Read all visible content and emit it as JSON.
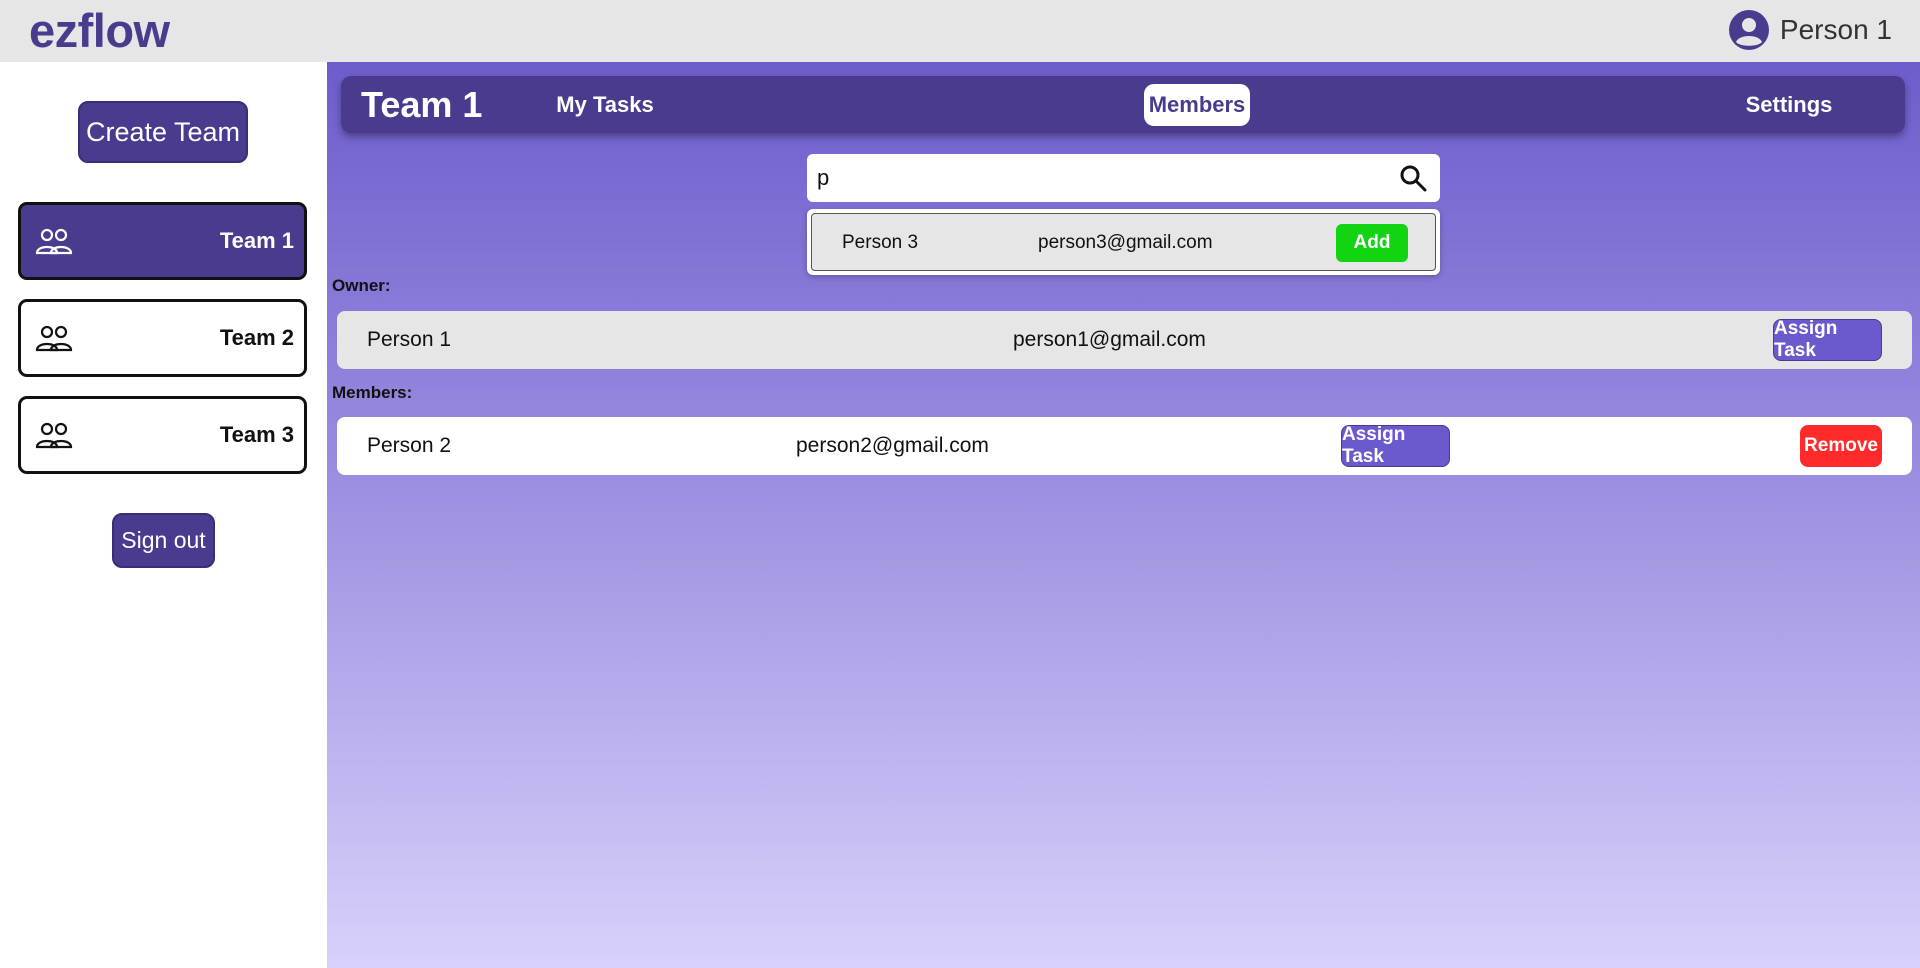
{
  "app": {
    "logo": "ezflow"
  },
  "user": {
    "name": "Person 1",
    "icon": "user-avatar-icon"
  },
  "sidebar": {
    "create_team_label": "Create Team",
    "teams": [
      {
        "label": "Team 1",
        "icon": "team-icon",
        "active": true
      },
      {
        "label": "Team 2",
        "icon": "team-icon",
        "active": false
      },
      {
        "label": "Team 3",
        "icon": "team-icon",
        "active": false
      }
    ],
    "signout_label": "Sign out"
  },
  "team_nav": {
    "title": "Team 1",
    "tabs": [
      {
        "label": "My Tasks",
        "active": false
      },
      {
        "label": "Members",
        "active": true
      },
      {
        "label": "Settings",
        "active": false
      }
    ]
  },
  "search": {
    "value": "p",
    "icon": "search-icon"
  },
  "search_results": [
    {
      "name": "Person 3",
      "email": "person3@gmail.com",
      "action": "Add"
    }
  ],
  "owner": {
    "label": "Owner:",
    "name": "Person 1",
    "email": "person1@gmail.com",
    "assign_label": "Assign Task"
  },
  "members": {
    "label": "Members:",
    "items": [
      {
        "name": "Person 2",
        "email": "person2@gmail.com",
        "assign_label": "Assign Task",
        "remove_label": "Remove"
      }
    ]
  },
  "colors": {
    "brand": "#4a3b8f",
    "accent": "#6b5acd",
    "add": "#13d413",
    "remove": "#ff2a2a"
  }
}
